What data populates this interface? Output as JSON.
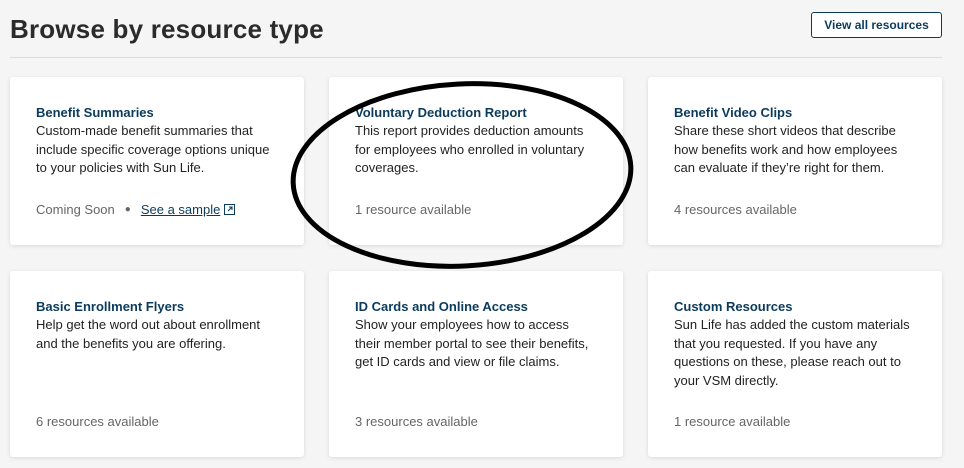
{
  "header": {
    "title": "Browse by resource type",
    "view_all_label": "View all resources"
  },
  "cards": [
    {
      "title": "Benefit Summaries",
      "description": "Custom-made benefit summaries that include specific coverage options unique to your policies with Sun Life.",
      "status": "Coming Soon",
      "link_label": "See a sample",
      "link_icon": "external-link-icon"
    },
    {
      "title": "Voluntary Deduction Report",
      "description": "This report provides deduction amounts for employees who enrolled in voluntary coverages.",
      "footer": "1 resource available"
    },
    {
      "title": "Benefit Video Clips",
      "description": "Share these short videos that describe how benefits work and how employees can evaluate if they’re right for them.",
      "footer": "4 resources available"
    },
    {
      "title": "Basic Enrollment Flyers",
      "description": "Help get the word out about enrollment and the benefits you are offering.",
      "footer": "6 resources available"
    },
    {
      "title": "ID Cards and Online Access",
      "description": "Show your employees how to access their member portal to see their benefits, get ID cards and view or file claims.",
      "footer": "3 resources available"
    },
    {
      "title": "Custom Resources",
      "description": "Sun Life has added the custom materials that you requested. If you have any questions on these, please reach out to your VSM directly.",
      "footer": "1 resource available"
    }
  ],
  "colors": {
    "title_blue": "#0b3b5c",
    "background": "#f5f5f5",
    "card": "#ffffff",
    "annotation": "#000000"
  }
}
